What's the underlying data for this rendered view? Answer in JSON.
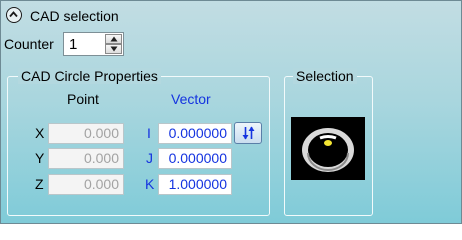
{
  "section": {
    "title": "CAD selection",
    "collapse_icon": "chevron-up-circle-icon"
  },
  "counter": {
    "label": "Counter",
    "value": "1"
  },
  "cad_circle": {
    "title": "CAD Circle Properties",
    "point_header": "Point",
    "vector_header": "Vector",
    "rows": [
      {
        "point_label": "X",
        "point_value": "0.000",
        "vector_label": "I",
        "vector_value": "0.000000"
      },
      {
        "point_label": "Y",
        "point_value": "0.000",
        "vector_label": "J",
        "vector_value": "0.000000"
      },
      {
        "point_label": "Z",
        "point_value": "0.000",
        "vector_label": "K",
        "vector_value": "1.000000"
      }
    ],
    "flip_icon": "flip-vector-icon"
  },
  "selection": {
    "title": "Selection"
  },
  "colors": {
    "accent_blue": "#1433e0",
    "background_top": "#c2dde3",
    "background_bottom": "#7fcbd8",
    "disabled_text": "#a3a3a3"
  }
}
